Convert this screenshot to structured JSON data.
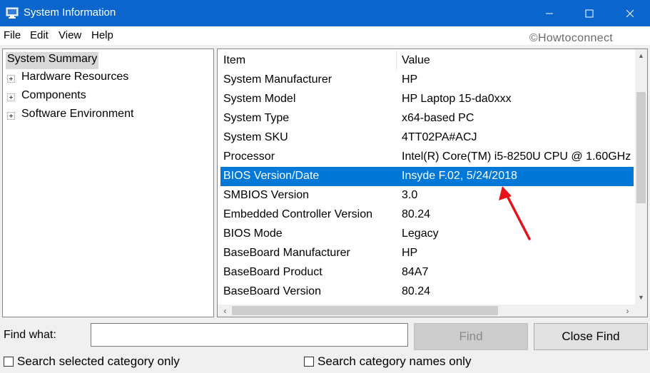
{
  "window": {
    "title": "System Information",
    "minimize_glyph": "—",
    "maximize_glyph": "☐",
    "close_glyph": "✕"
  },
  "menu": {
    "items": [
      "File",
      "Edit",
      "View",
      "Help"
    ]
  },
  "watermark": "©Howtoconnect",
  "tree": {
    "root": "System Summary",
    "nodes": [
      "Hardware Resources",
      "Components",
      "Software Environment"
    ]
  },
  "list": {
    "columns": [
      "Item",
      "Value"
    ],
    "rows": [
      {
        "item": "System Manufacturer",
        "value": "HP"
      },
      {
        "item": "System Model",
        "value": "HP Laptop 15-da0xxx"
      },
      {
        "item": "System Type",
        "value": "x64-based PC"
      },
      {
        "item": "System SKU",
        "value": "4TT02PA#ACJ"
      },
      {
        "item": "Processor",
        "value": "Intel(R) Core(TM) i5-8250U CPU @ 1.60GHz"
      },
      {
        "item": "BIOS Version/Date",
        "value": "Insyde F.02, 5/24/2018"
      },
      {
        "item": "SMBIOS Version",
        "value": "3.0"
      },
      {
        "item": "Embedded Controller Version",
        "value": "80.24"
      },
      {
        "item": "BIOS Mode",
        "value": "Legacy"
      },
      {
        "item": "BaseBoard Manufacturer",
        "value": "HP"
      },
      {
        "item": "BaseBoard Product",
        "value": "84A7"
      },
      {
        "item": "BaseBoard Version",
        "value": "80.24"
      }
    ],
    "selected_row": "BIOS Version/Date",
    "selection_color": "#0078d7"
  },
  "find": {
    "label": "Find what:",
    "value": "",
    "find_button": "Find",
    "close_button": "Close Find",
    "search_selected_label": "Search selected category only",
    "search_names_label": "Search category names only",
    "search_selected_checked": false,
    "search_names_checked": false
  },
  "colors": {
    "titlebar": "#0a66cc",
    "annotation_arrow": "#e8101a"
  }
}
